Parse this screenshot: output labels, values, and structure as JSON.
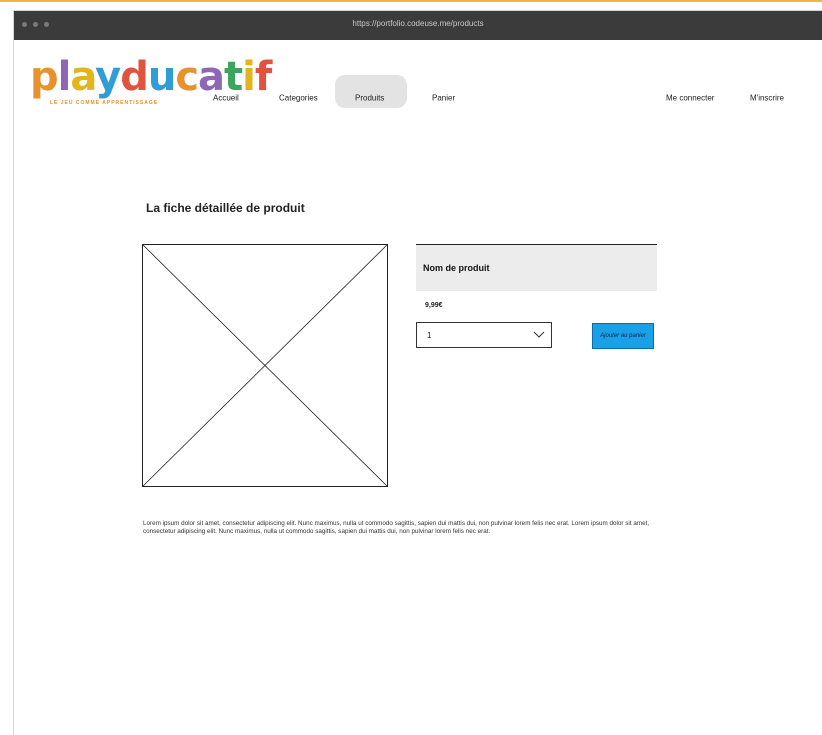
{
  "browser": {
    "url": "https://portfolio.codeuse.me/products"
  },
  "brand": {
    "logo_text": "playducatif",
    "tagline": "LE JEU COMME APPRENTISSAGE",
    "letter_colors": [
      "#e7922e",
      "#8e66b7",
      "#e2b51c",
      "#2f9dd6",
      "#e0533f",
      "#2f9dd6",
      "#e7922e",
      "#8e66b7",
      "#3aa55c",
      "#e2b51c",
      "#e0533f"
    ]
  },
  "nav": {
    "accueil": "Accueil",
    "categories": "Categories",
    "produits": "Produits",
    "panier": "Panier",
    "login": "Me connecter",
    "signup": "M'inscrire"
  },
  "page": {
    "title": "La fiche détaillée de produit"
  },
  "product": {
    "name": "Nom de produit",
    "price": "9,99€",
    "quantity_selected": "1",
    "add_to_cart_label": "Ajouter au panier",
    "description": "Lorem ipsum dolor sit amet, consectetur adipiscing elit. Nunc maximus, nulla ut commodo sagittis, sapien dui mattis dui, non pulvinar lorem felis nec erat. Lorem ipsum dolor sit amet, consectetur adipiscing elit. Nunc maximus, nulla ut commodo sagittis, sapien dui mattis dui, non pulvinar lorem felis nec erat."
  },
  "colors": {
    "accent_button": "#1aa0e6",
    "active_nav_bg": "#e3e3e3",
    "titlebar": "#3b3b3b"
  }
}
